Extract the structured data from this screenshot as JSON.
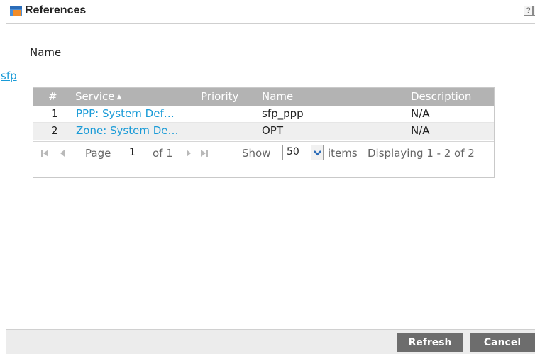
{
  "window": {
    "title": "References",
    "help_label": "?",
    "close_label": "×"
  },
  "name_label": "Name",
  "object_name": "sfp",
  "table": {
    "columns": [
      "#",
      "Service",
      "Priority",
      "Name",
      "Description"
    ],
    "sort_indicator": "▲",
    "rows": [
      {
        "num": "1",
        "service": "PPP: System Def…",
        "priority": "",
        "name": "sfp_ppp",
        "description": "N/A"
      },
      {
        "num": "2",
        "service": "Zone: System De…",
        "priority": "",
        "name": "OPT",
        "description": "N/A"
      }
    ]
  },
  "pager": {
    "page_label": "Page",
    "current_page": "1",
    "of_label": "of 1",
    "show_label": "Show",
    "page_size": "50",
    "items_label": "items",
    "displaying": "Displaying 1 - 2 of 2"
  },
  "footer": {
    "refresh_label": "Refresh",
    "cancel_label": "Cancel"
  },
  "colors": {
    "link": "#1a9bd7",
    "header_bg": "#b3b3b3",
    "button_bg": "#6d6d6d",
    "footer_bg": "#ececec"
  },
  "icons": [
    "references-window-icon",
    "help-icon",
    "close-icon",
    "sort-ascending-icon",
    "first-page-icon",
    "prev-page-icon",
    "next-page-icon",
    "last-page-icon",
    "chevron-down-icon"
  ]
}
